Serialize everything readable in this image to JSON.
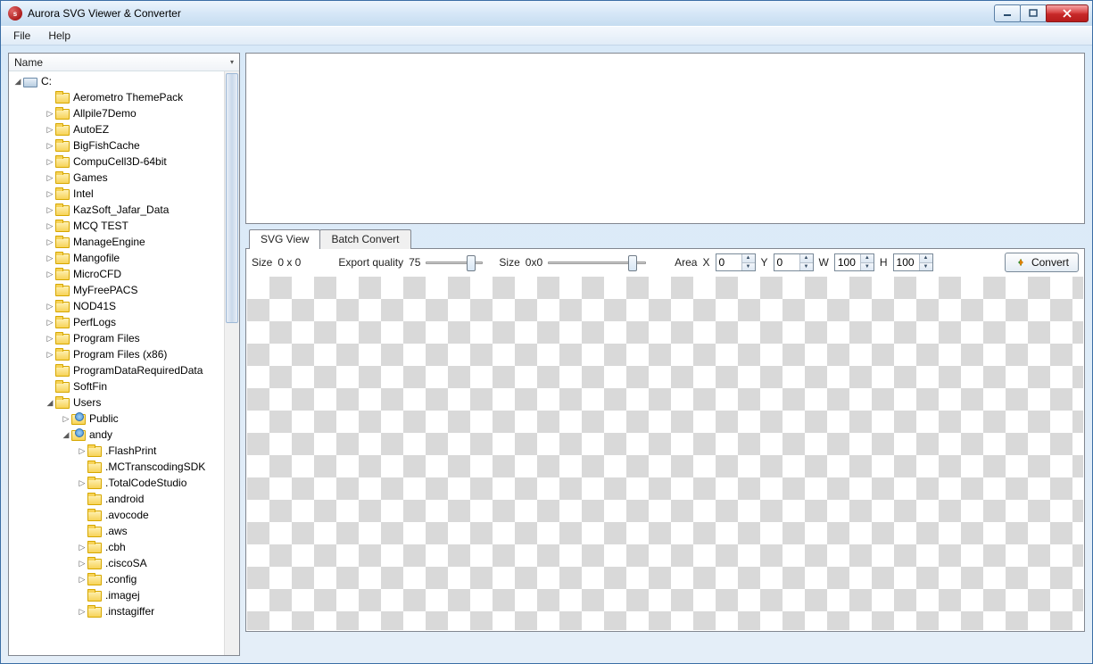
{
  "window": {
    "title": "Aurora SVG Viewer & Converter"
  },
  "menu": {
    "file": "File",
    "help": "Help"
  },
  "tree": {
    "header": "Name",
    "root": "C:",
    "items": [
      {
        "label": "Aerometro ThemePack",
        "expander": "none",
        "depth": 2,
        "icon": "folder"
      },
      {
        "label": "Allpile7Demo",
        "expander": "closed",
        "depth": 2,
        "icon": "folder"
      },
      {
        "label": "AutoEZ",
        "expander": "closed",
        "depth": 2,
        "icon": "folder"
      },
      {
        "label": "BigFishCache",
        "expander": "closed",
        "depth": 2,
        "icon": "folder"
      },
      {
        "label": "CompuCell3D-64bit",
        "expander": "closed",
        "depth": 2,
        "icon": "folder"
      },
      {
        "label": "Games",
        "expander": "closed",
        "depth": 2,
        "icon": "folder"
      },
      {
        "label": "Intel",
        "expander": "closed",
        "depth": 2,
        "icon": "folder"
      },
      {
        "label": "KazSoft_Jafar_Data",
        "expander": "closed",
        "depth": 2,
        "icon": "folder"
      },
      {
        "label": "MCQ TEST",
        "expander": "closed",
        "depth": 2,
        "icon": "folder"
      },
      {
        "label": "ManageEngine",
        "expander": "closed",
        "depth": 2,
        "icon": "folder"
      },
      {
        "label": "Mangofile",
        "expander": "closed",
        "depth": 2,
        "icon": "folder"
      },
      {
        "label": "MicroCFD",
        "expander": "closed",
        "depth": 2,
        "icon": "folder"
      },
      {
        "label": "MyFreePACS",
        "expander": "none",
        "depth": 2,
        "icon": "folder"
      },
      {
        "label": "NOD41S",
        "expander": "closed",
        "depth": 2,
        "icon": "folder"
      },
      {
        "label": "PerfLogs",
        "expander": "closed",
        "depth": 2,
        "icon": "folder"
      },
      {
        "label": "Program Files",
        "expander": "closed",
        "depth": 2,
        "icon": "folder"
      },
      {
        "label": "Program Files (x86)",
        "expander": "closed",
        "depth": 2,
        "icon": "folder"
      },
      {
        "label": "ProgramDataRequiredData",
        "expander": "none",
        "depth": 2,
        "icon": "folder"
      },
      {
        "label": "SoftFin",
        "expander": "none",
        "depth": 2,
        "icon": "folder"
      },
      {
        "label": "Users",
        "expander": "open",
        "depth": 2,
        "icon": "folder"
      },
      {
        "label": "Public",
        "expander": "closed",
        "depth": 3,
        "icon": "userfolder"
      },
      {
        "label": "andy",
        "expander": "open",
        "depth": 3,
        "icon": "userfolder"
      },
      {
        "label": ".FlashPrint",
        "expander": "closed",
        "depth": 4,
        "icon": "folder"
      },
      {
        "label": ".MCTranscodingSDK",
        "expander": "none",
        "depth": 4,
        "icon": "folder"
      },
      {
        "label": ".TotalCodeStudio",
        "expander": "closed",
        "depth": 4,
        "icon": "folder"
      },
      {
        "label": ".android",
        "expander": "none",
        "depth": 4,
        "icon": "folder"
      },
      {
        "label": ".avocode",
        "expander": "none",
        "depth": 4,
        "icon": "folder"
      },
      {
        "label": ".aws",
        "expander": "none",
        "depth": 4,
        "icon": "folder"
      },
      {
        "label": ".cbh",
        "expander": "closed",
        "depth": 4,
        "icon": "folder"
      },
      {
        "label": ".ciscoSA",
        "expander": "closed",
        "depth": 4,
        "icon": "folder"
      },
      {
        "label": ".config",
        "expander": "closed",
        "depth": 4,
        "icon": "folder"
      },
      {
        "label": ".imagej",
        "expander": "none",
        "depth": 4,
        "icon": "folder"
      },
      {
        "label": ".instagiffer",
        "expander": "closed",
        "depth": 4,
        "icon": "folder"
      }
    ]
  },
  "tabs": {
    "svg_view": "SVG View",
    "batch_convert": "Batch Convert"
  },
  "controls": {
    "size_label": "Size",
    "size_value": "0 x 0",
    "export_quality_label": "Export  quality",
    "export_quality_value": "75",
    "size2_label": "Size",
    "size2_value": "0x0",
    "area_label": "Area",
    "x_label": "X",
    "x_value": "0",
    "y_label": "Y",
    "y_value": "0",
    "w_label": "W",
    "w_value": "100",
    "h_label": "H",
    "h_value": "100",
    "convert_label": "Convert"
  }
}
